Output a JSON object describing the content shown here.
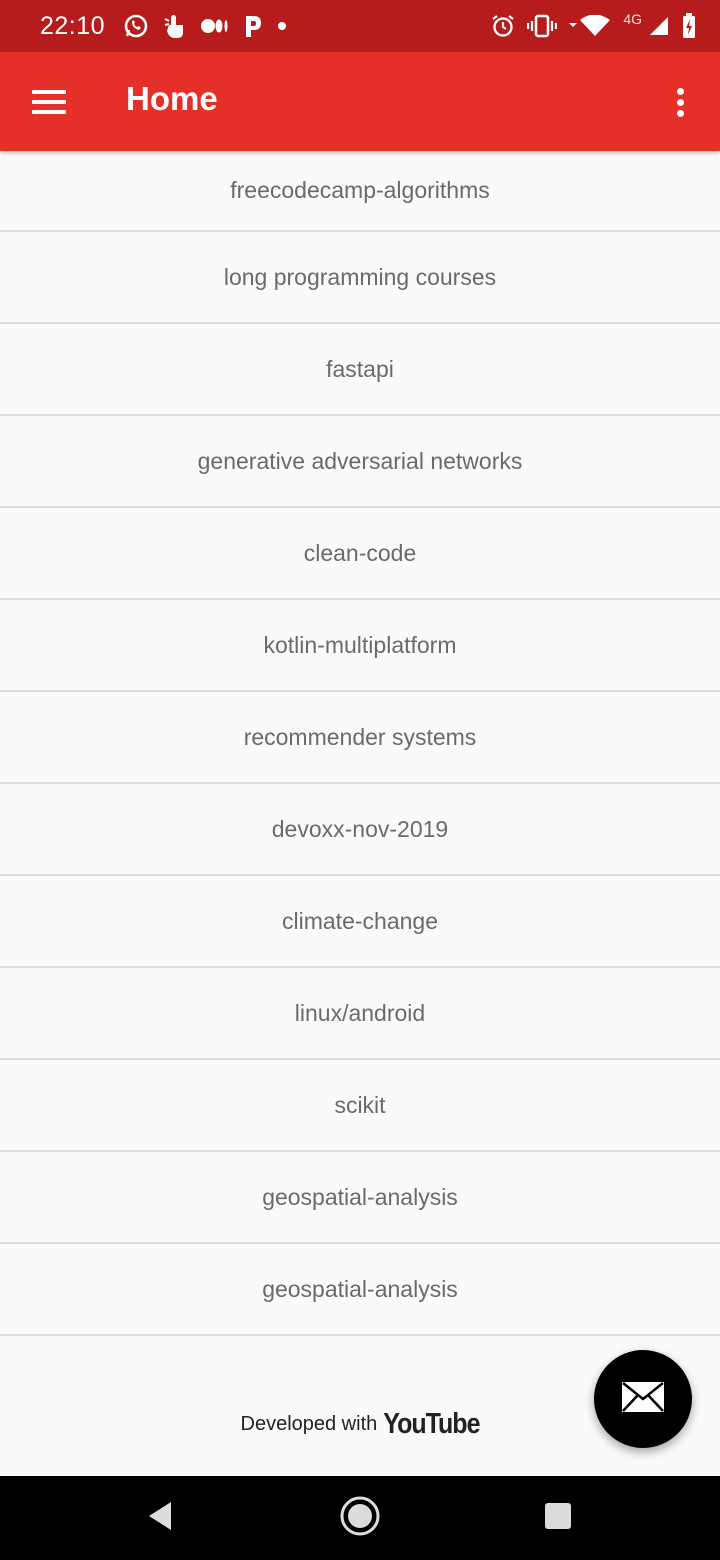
{
  "status_bar": {
    "time": "22:10",
    "network": "4G",
    "left_icons": [
      "whatsapp-icon",
      "touch-icon",
      "medium-icon",
      "p-icon",
      "dot-icon"
    ],
    "right_icons": [
      "alarm-icon",
      "vibrate-icon",
      "wifi-icon",
      "signal-icon",
      "battery-charging-icon"
    ]
  },
  "app_bar": {
    "title": "Home",
    "color": "#e53029",
    "status_color": "#b71c1c"
  },
  "topics": [
    "freecodecamp-algorithms",
    "long programming courses",
    "fastapi",
    "generative adversarial networks",
    "clean-code",
    "kotlin-multiplatform",
    "recommender systems",
    "devoxx-nov-2019",
    "climate-change",
    "linux/android",
    "scikit",
    "geospatial-analysis",
    "geospatial-analysis"
  ],
  "footer": {
    "prefix": "Developed with",
    "brand": "YouTube"
  },
  "fab": {
    "icon": "mail-icon"
  },
  "nav": {
    "back": "back-icon",
    "home": "home-icon",
    "recents": "recents-icon"
  }
}
